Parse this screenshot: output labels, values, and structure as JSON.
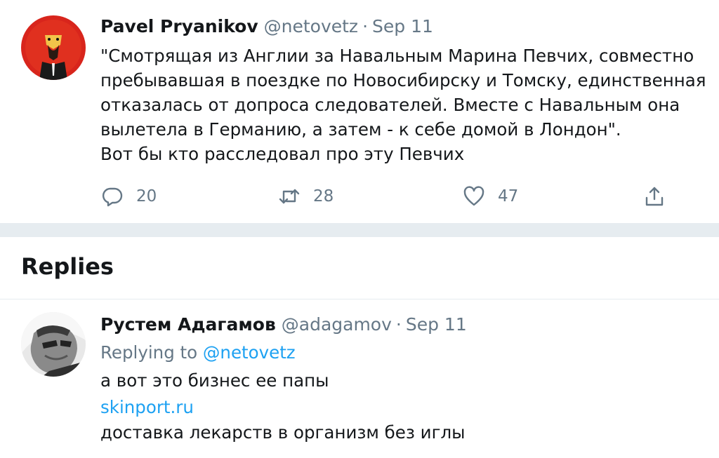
{
  "tweet": {
    "display_name": "Pavel Pryanikov",
    "handle": "@netovetz",
    "separator": "·",
    "date": "Sep 11",
    "text": "\"Смотрящая из Англии за Навальным Марина Певчих, совместно\nпребывавшая в поездке по Новосибирску и Томску, единственная\nотказалась от допроса следователей. Вместе с Навальным она\nвылетела в Германию, а затем - к себе домой в Лондон\".\nВот бы кто расследовал про эту Певчих",
    "actions": {
      "reply": {
        "icon": "reply-icon",
        "count": "20"
      },
      "retweet": {
        "icon": "retweet-icon",
        "count": "28"
      },
      "like": {
        "icon": "heart-icon",
        "count": "47"
      },
      "share": {
        "icon": "share-icon"
      }
    }
  },
  "replies_section": {
    "title": "Replies"
  },
  "reply": {
    "display_name": "Рустем Адагамов",
    "handle": "@adagamov",
    "separator": "·",
    "date": "Sep 11",
    "replying_prefix": "Replying to",
    "replying_handle": "@netovetz",
    "lines": [
      "а вот это бизнес ее папы",
      "skinport.ru",
      "доставка лекарств в организм без иглы"
    ]
  },
  "colors": {
    "text_primary": "#14171a",
    "text_secondary": "#657786",
    "link": "#1da1f2",
    "separator": "#e6ecf0"
  }
}
